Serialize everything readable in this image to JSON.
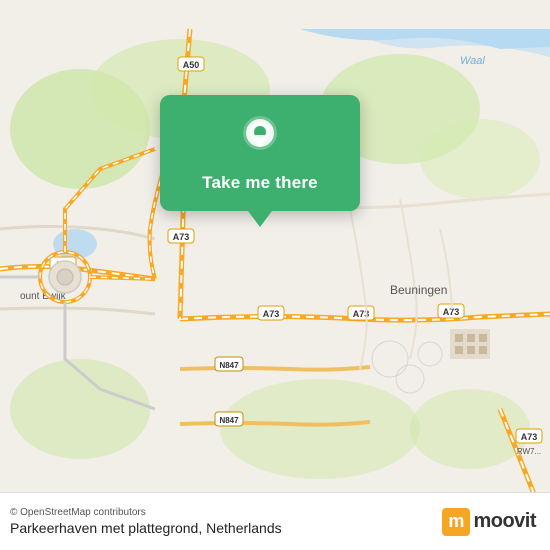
{
  "map": {
    "background_color": "#f2efe9"
  },
  "popup": {
    "button_label": "Take me there",
    "bg_color": "#3daf6e"
  },
  "bottom_bar": {
    "credit": "© OpenStreetMap contributors",
    "location_name": "Parkeerhaven met plattegrond, Netherlands",
    "moovit_letter": "m",
    "moovit_text": "moovit"
  }
}
